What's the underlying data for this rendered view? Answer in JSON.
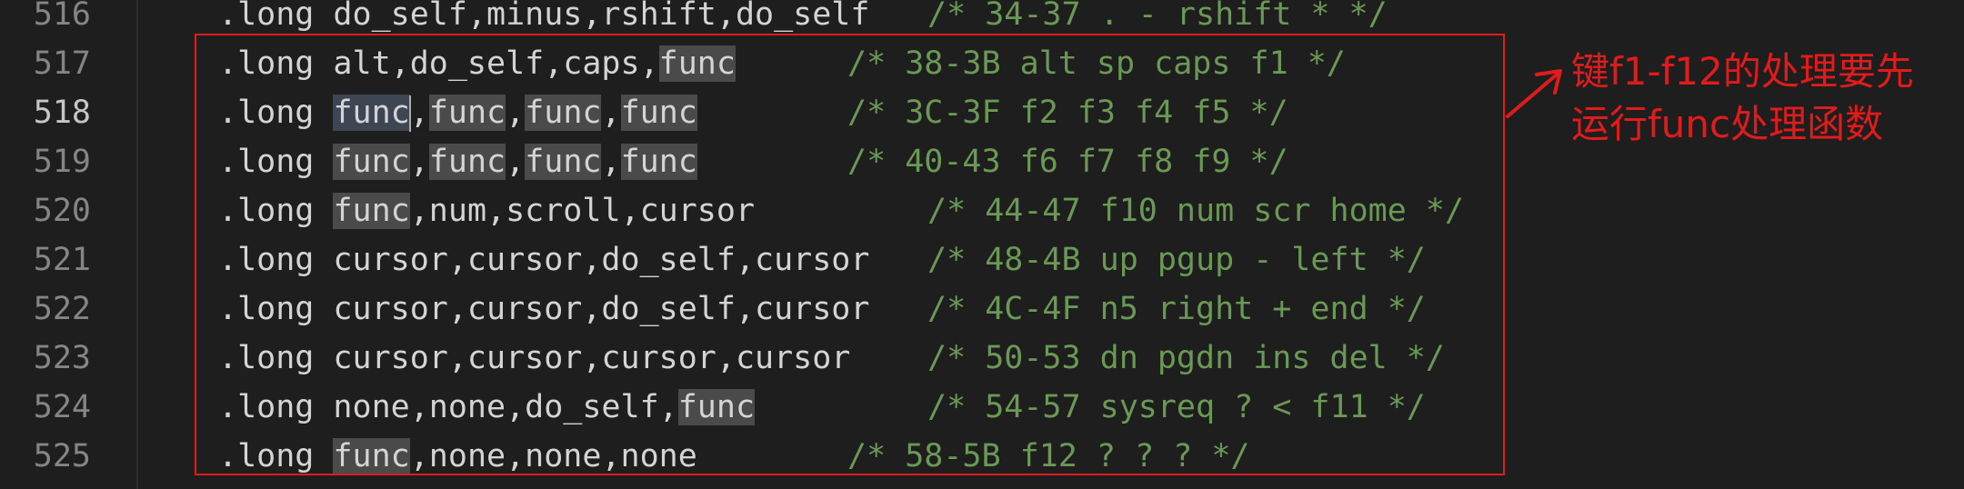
{
  "editor": {
    "active_line": "518",
    "lines": [
      {
        "num": "516",
        "code": ".long do_self,minus,rshift,do_self",
        "comment": "/* 34-37 . - rshift * */"
      },
      {
        "num": "517",
        "code_parts": [
          ".long alt,do_self,caps,",
          "func"
        ],
        "comment": "/* 38-3B alt sp caps f1 */"
      },
      {
        "num": "518",
        "code_parts": [
          ".long ",
          "func",
          ",",
          "func",
          ",",
          "func",
          ",",
          "func"
        ],
        "comment": "/* 3C-3F f2 f3 f4 f5 */"
      },
      {
        "num": "519",
        "code_parts": [
          ".long ",
          "func",
          ",",
          "func",
          ",",
          "func",
          ",",
          "func"
        ],
        "comment": "/* 40-43 f6 f7 f8 f9 */"
      },
      {
        "num": "520",
        "code_parts": [
          ".long ",
          "func",
          ",num,scroll,cursor"
        ],
        "comment": "/* 44-47 f10 num scr home */"
      },
      {
        "num": "521",
        "code": ".long cursor,cursor,do_self,cursor",
        "comment": "/* 48-4B up pgup - left */"
      },
      {
        "num": "522",
        "code": ".long cursor,cursor,do_self,cursor",
        "comment": "/* 4C-4F n5 right + end */"
      },
      {
        "num": "523",
        "code": ".long cursor,cursor,cursor,cursor",
        "comment": "/* 50-53 dn pgdn ins del */"
      },
      {
        "num": "524",
        "code_parts": [
          ".long none,none,do_self,",
          "func"
        ],
        "comment": "/* 54-57 sysreq ? < f11 */"
      },
      {
        "num": "525",
        "code_parts": [
          ".long ",
          "func",
          ",none,none,none"
        ],
        "comment": "/* 58-5B f12 ? ? ? */"
      }
    ]
  },
  "annotation": {
    "line1": "键f1-f12的处理要先",
    "line2": "运行func处理函数",
    "color": "#e01b1b"
  }
}
